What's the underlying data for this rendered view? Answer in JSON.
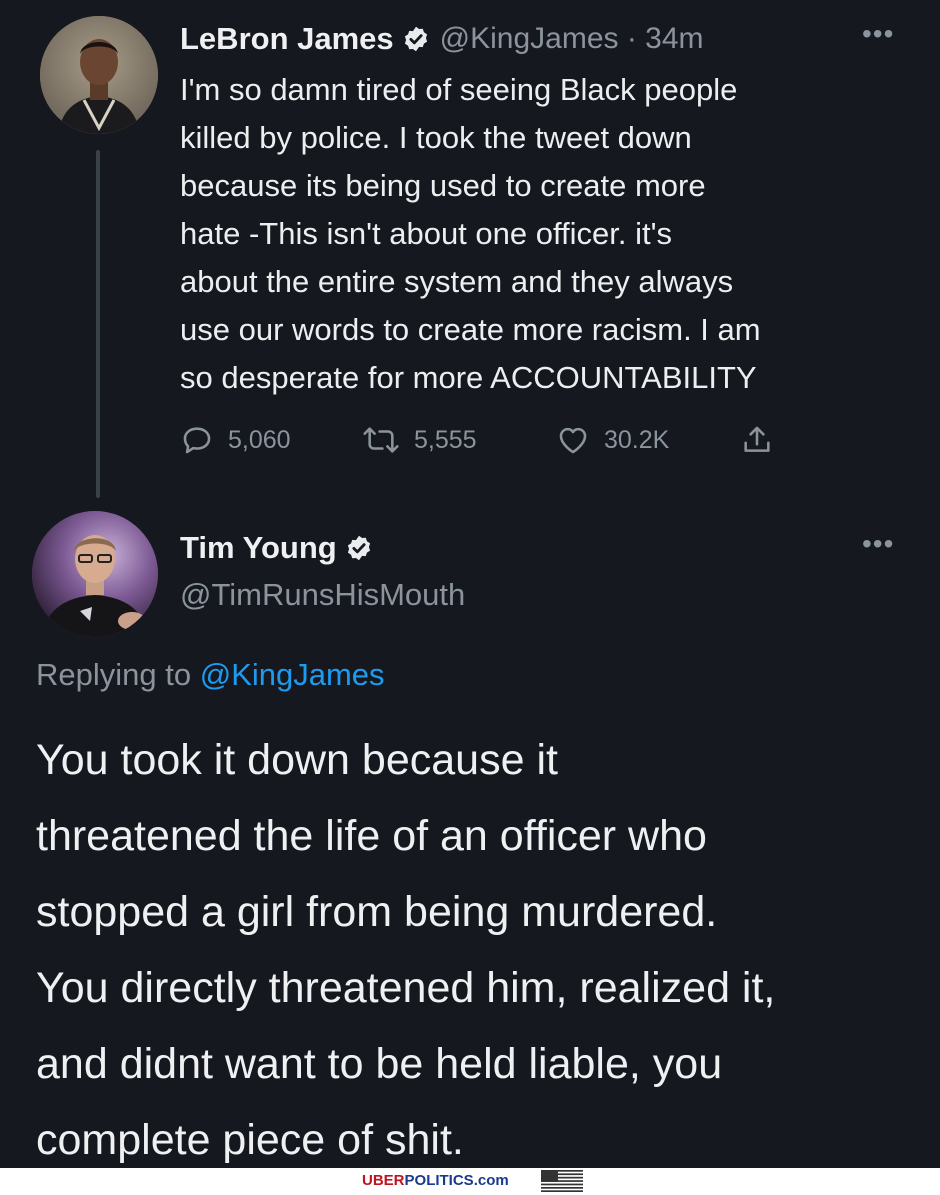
{
  "parent_tweet": {
    "author_name": "LeBron James",
    "handle_time": "@KingJames · 34m",
    "more_label": "•••",
    "text": "I'm so damn tired of seeing Black people\nkilled by police. I took the tweet down\nbecause its being used to create more\nhate -This isn't about one officer.  it's\nabout the entire system and they always\nuse our words to create more racism. I am\nso desperate for more ACCOUNTABILITY",
    "replies": "5,060",
    "retweets": "5,555",
    "likes": "30.2K"
  },
  "reply_tweet": {
    "author_name": "Tim Young",
    "handle": "@TimRunsHisMouth",
    "more_label": "•••",
    "replying_prefix": "Replying to ",
    "replying_handle": "@KingJames",
    "text": "You took it down because it\nthreatened the life of an officer who\nstopped a girl from being murdered.\nYou directly threatened him, realized it,\nand didnt want to be held liable, you\ncomplete piece of shit."
  },
  "watermark": {
    "uber": "UBER",
    "politics": "POLITICS",
    "com": ".com"
  },
  "icons": {
    "verified": "verified-badge-icon",
    "reply": "reply-bubble-icon",
    "retweet": "retweet-icon",
    "like": "heart-icon",
    "share": "share-icon",
    "more": "more-dots-icon",
    "flag": "us-flag-icon"
  },
  "colors": {
    "background": "#15181e",
    "text": "#eceef0",
    "muted": "#8b949c",
    "link": "#1d9bf0",
    "watermark_red": "#c1121f",
    "watermark_blue": "#1a3a8f"
  }
}
